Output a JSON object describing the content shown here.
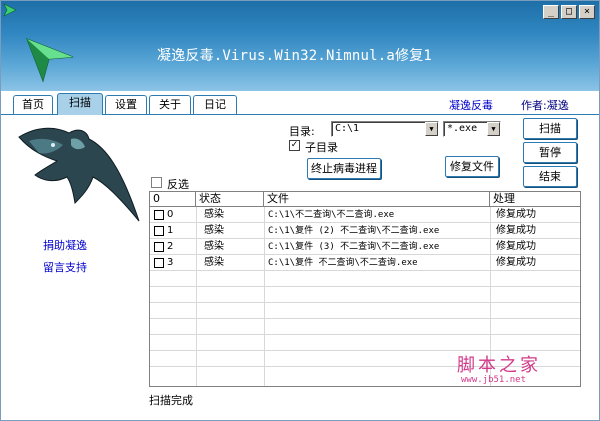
{
  "app": {
    "title": "凝逸反毒.Virus.Win32.Nimnul.a修复1"
  },
  "window_buttons": [
    "_",
    "□",
    "×"
  ],
  "tabs": [
    {
      "label": "首页",
      "active": false
    },
    {
      "label": "扫描",
      "active": true
    },
    {
      "label": "设置",
      "active": false
    },
    {
      "label": "关于",
      "active": false
    },
    {
      "label": "日记",
      "active": false
    }
  ],
  "header_links": {
    "brand": "凝逸反毒",
    "author": "作者:凝逸"
  },
  "left_links": {
    "donate": "捐助凝逸",
    "message": "留言支持"
  },
  "scan": {
    "dir_label": "目录:",
    "dir_value": "C:\\1",
    "ext_value": "*.exe",
    "subdir_label": "子目录",
    "subdir_checked": true,
    "invert_label": "反选",
    "invert_checked": false,
    "kill_btn": "终止病毒进程",
    "repair_btn": "修复文件",
    "scan_btn": "扫描",
    "pause_btn": "暂停",
    "end_btn": "结束"
  },
  "table": {
    "columns": [
      "0",
      "状态",
      "文件",
      "处理"
    ],
    "rows": [
      {
        "id": "0",
        "status": "感染",
        "file": "C:\\1\\不二查询\\不二查询.exe",
        "action": "修复成功"
      },
      {
        "id": "1",
        "status": "感染",
        "file": "C:\\1\\复件 (2) 不二查询\\不二查询.exe",
        "action": "修复成功"
      },
      {
        "id": "2",
        "status": "感染",
        "file": "C:\\1\\复件 (3) 不二查询\\不二查询.exe",
        "action": "修复成功"
      },
      {
        "id": "3",
        "status": "感染",
        "file": "C:\\1\\复件 不二查询\\不二查询.exe",
        "action": "修复成功"
      }
    ]
  },
  "status_text": "扫描完成",
  "watermark": {
    "main": "脚本之家",
    "sub": "www.jb51.net"
  },
  "colors": {
    "banner": "#2f86c0",
    "tab_active": "#a8d0e8",
    "link": "#0000cc",
    "watermark": "#d23a8a"
  }
}
